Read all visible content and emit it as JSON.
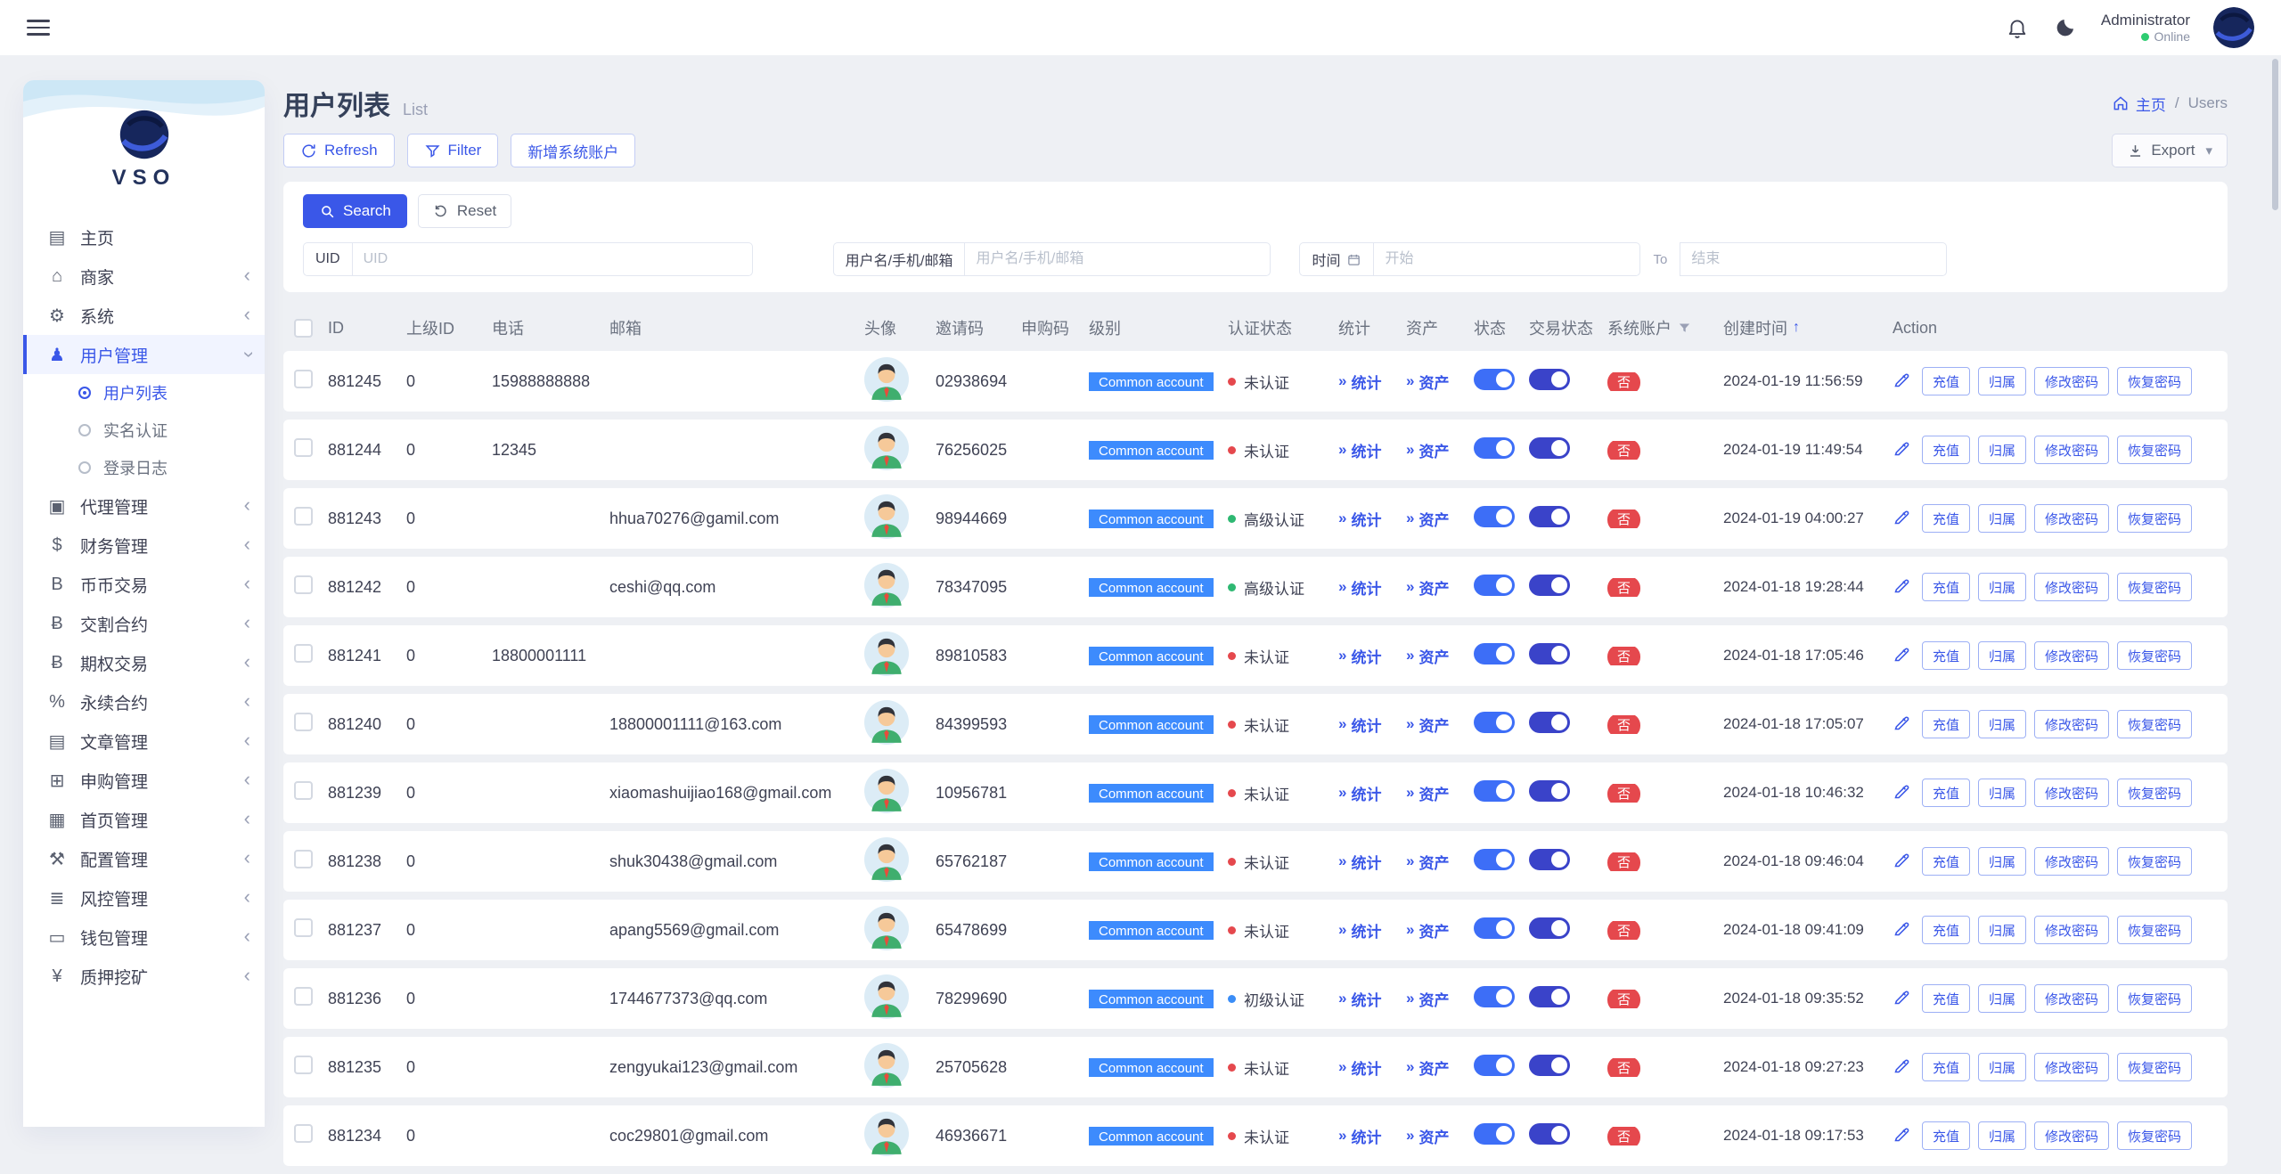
{
  "colors": {
    "primary": "#3a57e8",
    "level_badge": "#3d8bfd",
    "danger": "#e5484d",
    "success": "#2eb872",
    "info": "#3a8df7"
  },
  "topbar": {
    "user_name": "Administrator",
    "status": "Online"
  },
  "brand": {
    "name": "VSO"
  },
  "page": {
    "title": "用户列表",
    "subtitle": "List",
    "breadcrumb_home": "主页",
    "breadcrumb_sep": "/",
    "breadcrumb_current": "Users"
  },
  "toolbar": {
    "refresh": "Refresh",
    "filter": "Filter",
    "add_account": "新增系统账户",
    "export": "Export"
  },
  "search": {
    "search": "Search",
    "reset": "Reset",
    "uid_label": "UID",
    "uid_placeholder": "UID",
    "user_label": "用户名/手机/邮箱",
    "user_placeholder": "用户名/手机/邮箱",
    "time_label": "时间",
    "start_placeholder": "开始",
    "to": "To",
    "end_placeholder": "结束"
  },
  "sidebar": {
    "items": [
      {
        "key": "home",
        "label": "主页",
        "icon": "chart-icon",
        "glyph": "▤",
        "chevron": false
      },
      {
        "key": "merchant",
        "label": "商家",
        "icon": "store-icon",
        "glyph": "⌂",
        "chevron": true
      },
      {
        "key": "system",
        "label": "系统",
        "icon": "gear-icon",
        "glyph": "⚙",
        "chevron": true
      },
      {
        "key": "user-management",
        "label": "用户管理",
        "icon": "user-icon",
        "glyph": "♟",
        "chevron": true,
        "expanded": true,
        "active": true,
        "children": [
          {
            "key": "user-list",
            "label": "用户列表",
            "active": true
          },
          {
            "key": "kyc",
            "label": "实名认证"
          },
          {
            "key": "login-log",
            "label": "登录日志"
          }
        ]
      },
      {
        "key": "agent",
        "label": "代理管理",
        "icon": "id-card-icon",
        "glyph": "▣",
        "chevron": true
      },
      {
        "key": "finance",
        "label": "财务管理",
        "icon": "dollar-icon",
        "glyph": "$",
        "chevron": true
      },
      {
        "key": "spot-trade",
        "label": "币币交易",
        "icon": "coin-icon",
        "glyph": "B",
        "chevron": true
      },
      {
        "key": "delivery-contract",
        "label": "交割合约",
        "icon": "bitcoin-icon",
        "glyph": "Ƀ",
        "chevron": true
      },
      {
        "key": "options-trade",
        "label": "期权交易",
        "icon": "bitcoin-icon",
        "glyph": "Ƀ",
        "chevron": true
      },
      {
        "key": "perpetual-contract",
        "label": "永续合约",
        "icon": "percent-icon",
        "glyph": "%",
        "chevron": true
      },
      {
        "key": "article",
        "label": "文章管理",
        "icon": "article-icon",
        "glyph": "▤",
        "chevron": true
      },
      {
        "key": "subscription",
        "label": "申购管理",
        "icon": "plus-box-icon",
        "glyph": "⊞",
        "chevron": true
      },
      {
        "key": "homepage",
        "label": "首页管理",
        "icon": "grid-icon",
        "glyph": "▦",
        "chevron": true
      },
      {
        "key": "config",
        "label": "配置管理",
        "icon": "wrench-icon",
        "glyph": "⚒",
        "chevron": true
      },
      {
        "key": "risk-control",
        "label": "风控管理",
        "icon": "list-icon",
        "glyph": "≣",
        "chevron": true
      },
      {
        "key": "wallet",
        "label": "钱包管理",
        "icon": "wallet-icon",
        "glyph": "▭",
        "chevron": true
      },
      {
        "key": "staking",
        "label": "质押挖矿",
        "icon": "yen-icon",
        "glyph": "¥",
        "chevron": true
      }
    ]
  },
  "table": {
    "headers": [
      "ID",
      "上级ID",
      "电话",
      "邮箱",
      "头像",
      "邀请码",
      "申购码",
      "级别",
      "认证状态",
      "统计",
      "资产",
      "状态",
      "交易状态",
      "系统账户",
      "创建时间",
      "Action"
    ],
    "links": {
      "chevron": "»",
      "stats": "统计",
      "assets": "资产"
    },
    "labels": {
      "system_account_no": "否"
    },
    "action_buttons": [
      "充值",
      "归属",
      "修改密码",
      "恢复密码"
    ],
    "rows": [
      {
        "id": "881245",
        "parent_id": "0",
        "phone": "15988888888",
        "email": "",
        "invite_code": "02938694",
        "subscribe_code": "",
        "level": "Common account",
        "auth_status": "未认证",
        "auth_class": "none",
        "created_at": "2024-01-19 11:56:59"
      },
      {
        "id": "881244",
        "parent_id": "0",
        "phone": "12345",
        "email": "",
        "invite_code": "76256025",
        "subscribe_code": "",
        "level": "Common account",
        "auth_status": "未认证",
        "auth_class": "none",
        "created_at": "2024-01-19 11:49:54"
      },
      {
        "id": "881243",
        "parent_id": "0",
        "phone": "",
        "email": "hhua70276@gamil.com",
        "invite_code": "98944669",
        "subscribe_code": "",
        "level": "Common account",
        "auth_status": "高级认证",
        "auth_class": "advanced",
        "created_at": "2024-01-19 04:00:27"
      },
      {
        "id": "881242",
        "parent_id": "0",
        "phone": "",
        "email": "ceshi@qq.com",
        "invite_code": "78347095",
        "subscribe_code": "",
        "level": "Common account",
        "auth_status": "高级认证",
        "auth_class": "advanced",
        "created_at": "2024-01-18 19:28:44"
      },
      {
        "id": "881241",
        "parent_id": "0",
        "phone": "18800001111",
        "email": "",
        "invite_code": "89810583",
        "subscribe_code": "",
        "level": "Common account",
        "auth_status": "未认证",
        "auth_class": "none",
        "created_at": "2024-01-18 17:05:46"
      },
      {
        "id": "881240",
        "parent_id": "0",
        "phone": "",
        "email": "18800001111@163.com",
        "invite_code": "84399593",
        "subscribe_code": "",
        "level": "Common account",
        "auth_status": "未认证",
        "auth_class": "none",
        "created_at": "2024-01-18 17:05:07"
      },
      {
        "id": "881239",
        "parent_id": "0",
        "phone": "",
        "email": "xiaomashuijiao168@gmail.com",
        "invite_code": "10956781",
        "subscribe_code": "",
        "level": "Common account",
        "auth_status": "未认证",
        "auth_class": "none",
        "created_at": "2024-01-18 10:46:32"
      },
      {
        "id": "881238",
        "parent_id": "0",
        "phone": "",
        "email": "shuk30438@gmail.com",
        "invite_code": "65762187",
        "subscribe_code": "",
        "level": "Common account",
        "auth_status": "未认证",
        "auth_class": "none",
        "created_at": "2024-01-18 09:46:04"
      },
      {
        "id": "881237",
        "parent_id": "0",
        "phone": "",
        "email": "apang5569@gmail.com",
        "invite_code": "65478699",
        "subscribe_code": "",
        "level": "Common account",
        "auth_status": "未认证",
        "auth_class": "none",
        "created_at": "2024-01-18 09:41:09"
      },
      {
        "id": "881236",
        "parent_id": "0",
        "phone": "",
        "email": "1744677373@qq.com",
        "invite_code": "78299690",
        "subscribe_code": "",
        "level": "Common account",
        "auth_status": "初级认证",
        "auth_class": "primary",
        "created_at": "2024-01-18 09:35:52"
      },
      {
        "id": "881235",
        "parent_id": "0",
        "phone": "",
        "email": "zengyukai123@gmail.com",
        "invite_code": "25705628",
        "subscribe_code": "",
        "level": "Common account",
        "auth_status": "未认证",
        "auth_class": "none",
        "created_at": "2024-01-18 09:27:23"
      },
      {
        "id": "881234",
        "parent_id": "0",
        "phone": "",
        "email": "coc29801@gmail.com",
        "invite_code": "46936671",
        "subscribe_code": "",
        "level": "Common account",
        "auth_status": "未认证",
        "auth_class": "none",
        "created_at": "2024-01-18 09:17:53"
      }
    ]
  }
}
